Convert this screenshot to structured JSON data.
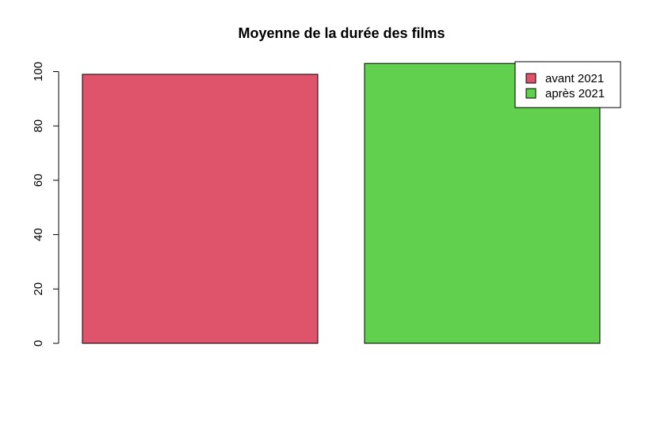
{
  "chart_data": {
    "type": "bar",
    "title": "Moyenne de la durée des films",
    "xlabel": "",
    "ylabel": "",
    "categories": [
      "avant 2021",
      "après 2021"
    ],
    "values": [
      99,
      103
    ],
    "colors": [
      "#DF536B",
      "#61D04F"
    ],
    "ylim": [
      0,
      100
    ],
    "yticks": [
      0,
      20,
      40,
      60,
      80,
      100
    ],
    "grid": false,
    "legend": {
      "position": "top-right",
      "entries": [
        {
          "label": "avant 2021",
          "color": "#DF536B"
        },
        {
          "label": "après 2021",
          "color": "#61D04F"
        }
      ]
    }
  }
}
